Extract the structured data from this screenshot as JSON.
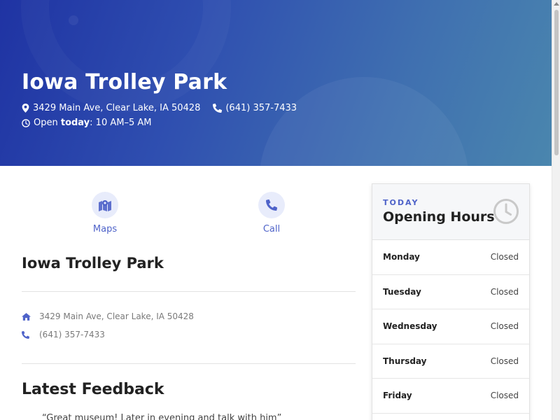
{
  "hero": {
    "title": "Iowa Trolley Park",
    "address": "3429 Main Ave, Clear Lake, IA 50428",
    "phone": "(641) 357-7433",
    "open_prefix": "Open ",
    "open_today": "today",
    "open_hours": ": 10 AM–5 AM"
  },
  "actions": [
    {
      "label": "Maps",
      "icon": "map-icon"
    },
    {
      "label": "Call",
      "icon": "phone-icon"
    }
  ],
  "business": {
    "name": "Iowa Trolley Park",
    "address": "3429 Main Ave, Clear Lake, IA 50428",
    "phone": "(641) 357-7433"
  },
  "feedback": {
    "title": "Latest Feedback",
    "first_quote": "“Great museum! Later in evening and talk with him”"
  },
  "hours": {
    "eyebrow": "TODAY",
    "title": "Opening Hours",
    "days": [
      {
        "day": "Monday",
        "status": "Closed"
      },
      {
        "day": "Tuesday",
        "status": "Closed"
      },
      {
        "day": "Wednesday",
        "status": "Closed"
      },
      {
        "day": "Thursday",
        "status": "Closed"
      },
      {
        "day": "Friday",
        "status": "Closed"
      }
    ]
  },
  "colors": {
    "accent": "#4f63c9",
    "hero_start": "#1f33a3",
    "hero_end": "#4a86ae"
  }
}
